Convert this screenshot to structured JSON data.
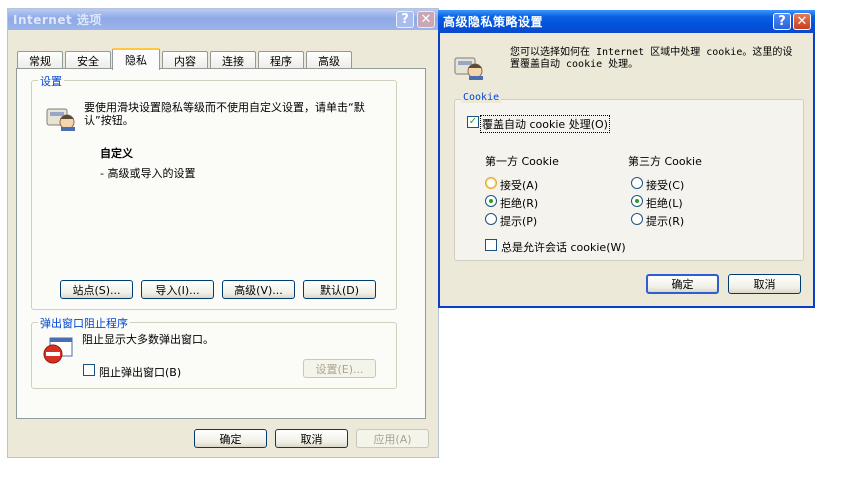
{
  "left_window": {
    "title": "Internet 选项",
    "tabs": [
      "常规",
      "安全",
      "隐私",
      "内容",
      "连接",
      "程序",
      "高级"
    ],
    "settings": {
      "label": "设置",
      "description": "要使用滑块设置隐私等级而不使用自定义设置，请单击“默认”按钮。",
      "level_title": "自定义",
      "level_desc": "- 高级或导入的设置"
    },
    "buttons": {
      "sites": "站点(S)...",
      "import": "导入(I)...",
      "advanced": "高级(V)...",
      "default": "默认(D)"
    },
    "popup": {
      "label": "弹出窗口阻止程序",
      "description": "阻止显示大多数弹出窗口。",
      "checkbox": "阻止弹出窗口(B)",
      "settings_button": "设置(E)..."
    },
    "footer": {
      "ok": "确定",
      "cancel": "取消",
      "apply": "应用(A)"
    }
  },
  "right_window": {
    "title": "高级隐私策略设置",
    "intro": "您可以选择如何在 Internet 区域中处理 cookie。这里的设置覆盖自动 cookie 处理。",
    "group_label": "Cookie",
    "override_checkbox": "覆盖自动 cookie 处理(O)",
    "first_party": {
      "heading": "第一方 Cookie",
      "options": [
        "接受(A)",
        "拒绝(R)",
        "提示(P)"
      ],
      "selected": "拒绝(R)"
    },
    "third_party": {
      "heading": "第三方 Cookie",
      "options": [
        "接受(C)",
        "拒绝(L)",
        "提示(R)"
      ],
      "selected": "拒绝(L)"
    },
    "session_checkbox": "总是允许会话 cookie(W)",
    "ok": "确定",
    "cancel": "取消"
  },
  "colors": {
    "titlebar_active": "#0a5fe0",
    "titlebar_inactive": "#8ea9e6",
    "dialog_bg": "#ece9d8",
    "accent_text": "#0046d5"
  }
}
